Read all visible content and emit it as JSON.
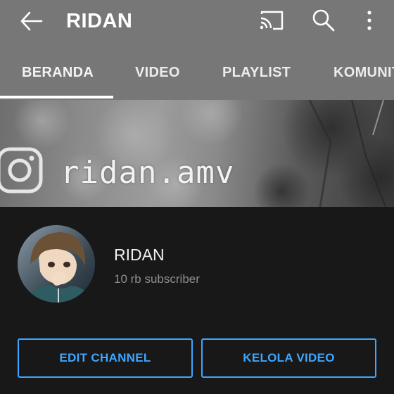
{
  "header": {
    "title": "RIDAN",
    "icons": [
      "back-arrow-icon",
      "cast-icon",
      "search-icon",
      "more-vert-icon"
    ]
  },
  "tabs": [
    {
      "label": "BERANDA",
      "active": true
    },
    {
      "label": "VIDEO",
      "active": false
    },
    {
      "label": "PLAYLIST",
      "active": false
    },
    {
      "label": "KOMUNITAS",
      "active": false
    }
  ],
  "banner": {
    "handle_text": "ridan.amv",
    "icon": "instagram-icon"
  },
  "channel": {
    "name": "RIDAN",
    "subscribers": "10 rb subscriber"
  },
  "actions": {
    "edit_channel": "EDIT CHANNEL",
    "manage_videos": "KELOLA VIDEO"
  },
  "colors": {
    "header_bg": "#777777",
    "page_bg": "#181818",
    "accent": "#3ea6ff"
  }
}
